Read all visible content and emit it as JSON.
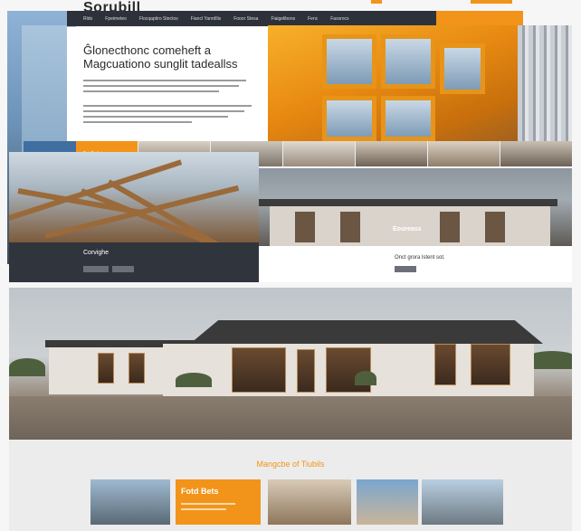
{
  "header": {
    "brand": "Sorubill",
    "nav": [
      "Rldo",
      "Fpeimeteo",
      "Flocqaptiro Stectos",
      "Fiancl Yanrdllis",
      "Fooor Stesa",
      "Fiaigelibons",
      "Fenc",
      "Fassrocs"
    ],
    "cta_label": ""
  },
  "hero": {
    "title": "Ĝlonecthonc comeheft a Magcuationo sunglit tadeallss"
  },
  "strip": {
    "orange_label": "Fat Fatiotas"
  },
  "timber_panel": {
    "title": "Corvighe"
  },
  "house_panel": {
    "label": "Eoureass",
    "text": "Onct grora lstent sot."
  },
  "section": {
    "title": "Mangcbe of Tiubils"
  },
  "cards": {
    "orange_title": "Fotd Bets"
  }
}
